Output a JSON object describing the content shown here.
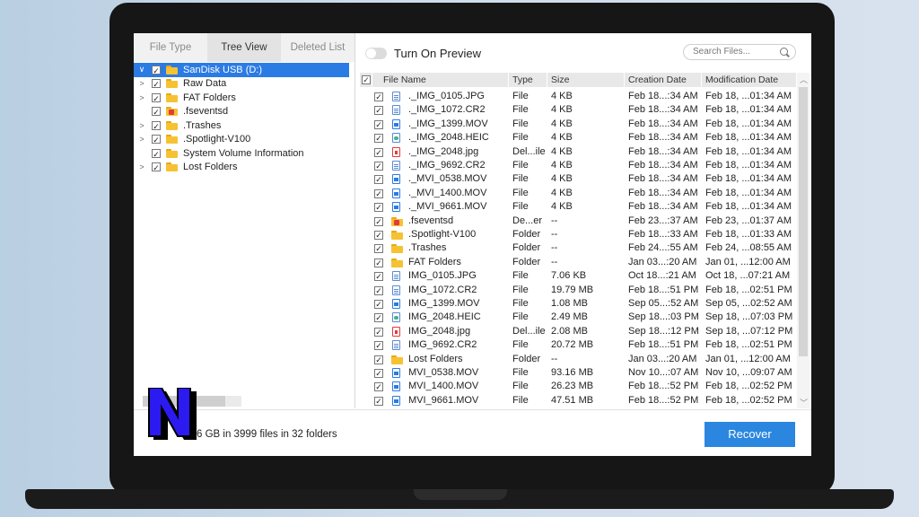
{
  "tabs": [
    "File Type",
    "Tree View",
    "Deleted List"
  ],
  "tree": [
    {
      "label": "SanDisk USB (D:)",
      "chevron": "∨",
      "checked": true,
      "selected": true
    },
    {
      "label": "Raw Data",
      "chevron": ">",
      "checked": true
    },
    {
      "label": "FAT Folders",
      "chevron": ">",
      "checked": true
    },
    {
      "label": ".fseventsd",
      "chevron": "",
      "checked": true,
      "locked": true
    },
    {
      "label": ".Trashes",
      "chevron": ">",
      "checked": true
    },
    {
      "label": ".Spotlight-V100",
      "chevron": ">",
      "checked": true
    },
    {
      "label": "System Volume Information",
      "chevron": "",
      "checked": true
    },
    {
      "label": "Lost Folders",
      "chevron": ">",
      "checked": true
    }
  ],
  "preview": {
    "label": "Turn On Preview"
  },
  "search": {
    "placeholder": "Search Files..."
  },
  "columns": [
    "File Name",
    "Type",
    "Size",
    "Creation Date",
    "Modification Date"
  ],
  "files": [
    {
      "name": "._IMG_0105.JPG",
      "type": "File",
      "size": "4 KB",
      "created": "Feb 18...:34 AM",
      "modified": "Feb 18, ...01:34 AM",
      "icon": "img"
    },
    {
      "name": "._IMG_1072.CR2",
      "type": "File",
      "size": "4 KB",
      "created": "Feb 18...:34 AM",
      "modified": "Feb 18, ...01:34 AM",
      "icon": "img"
    },
    {
      "name": "._IMG_1399.MOV",
      "type": "File",
      "size": "4 KB",
      "created": "Feb 18...:34 AM",
      "modified": "Feb 18, ...01:34 AM",
      "icon": "mov"
    },
    {
      "name": "._IMG_2048.HEIC",
      "type": "File",
      "size": "4 KB",
      "created": "Feb 18...:34 AM",
      "modified": "Feb 18, ...01:34 AM",
      "icon": "heic"
    },
    {
      "name": "._IMG_2048.jpg",
      "type": "Del...ile",
      "size": "4 KB",
      "created": "Feb 18...:34 AM",
      "modified": "Feb 18, ...01:34 AM",
      "icon": "del"
    },
    {
      "name": "._IMG_9692.CR2",
      "type": "File",
      "size": "4 KB",
      "created": "Feb 18...:34 AM",
      "modified": "Feb 18, ...01:34 AM",
      "icon": "img"
    },
    {
      "name": "._MVI_0538.MOV",
      "type": "File",
      "size": "4 KB",
      "created": "Feb 18...:34 AM",
      "modified": "Feb 18, ...01:34 AM",
      "icon": "mov"
    },
    {
      "name": "._MVI_1400.MOV",
      "type": "File",
      "size": "4 KB",
      "created": "Feb 18...:34 AM",
      "modified": "Feb 18, ...01:34 AM",
      "icon": "mov"
    },
    {
      "name": "._MVI_9661.MOV",
      "type": "File",
      "size": "4 KB",
      "created": "Feb 18...:34 AM",
      "modified": "Feb 18, ...01:34 AM",
      "icon": "mov"
    },
    {
      "name": ".fseventsd",
      "type": "De...er",
      "size": "--",
      "created": "Feb 23...:37 AM",
      "modified": "Feb 23, ...01:37 AM",
      "icon": "folder-locked"
    },
    {
      "name": ".Spotlight-V100",
      "type": "Folder",
      "size": "--",
      "created": "Feb 18...:33 AM",
      "modified": "Feb 18, ...01:33 AM",
      "icon": "folder"
    },
    {
      "name": ".Trashes",
      "type": "Folder",
      "size": "--",
      "created": "Feb 24...:55 AM",
      "modified": "Feb 24, ...08:55 AM",
      "icon": "folder"
    },
    {
      "name": "FAT Folders",
      "type": "Folder",
      "size": "--",
      "created": "Jan 03...:20 AM",
      "modified": "Jan 01, ...12:00 AM",
      "icon": "folder"
    },
    {
      "name": "IMG_0105.JPG",
      "type": "File",
      "size": "7.06 KB",
      "created": "Oct 18...:21 AM",
      "modified": "Oct 18, ...07:21 AM",
      "icon": "img"
    },
    {
      "name": "IMG_1072.CR2",
      "type": "File",
      "size": "19.79 MB",
      "created": "Feb 18...:51 PM",
      "modified": "Feb 18, ...02:51 PM",
      "icon": "img"
    },
    {
      "name": "IMG_1399.MOV",
      "type": "File",
      "size": "1.08 MB",
      "created": "Sep 05...:52 AM",
      "modified": "Sep 05, ...02:52 AM",
      "icon": "mov"
    },
    {
      "name": "IMG_2048.HEIC",
      "type": "File",
      "size": "2.49 MB",
      "created": "Sep 18...:03 PM",
      "modified": "Sep 18, ...07:03 PM",
      "icon": "heic"
    },
    {
      "name": "IMG_2048.jpg",
      "type": "Del...ile",
      "size": "2.08 MB",
      "created": "Sep 18...:12 PM",
      "modified": "Sep 18, ...07:12 PM",
      "icon": "del"
    },
    {
      "name": "IMG_9692.CR2",
      "type": "File",
      "size": "20.72 MB",
      "created": "Feb 18...:51 PM",
      "modified": "Feb 18, ...02:51 PM",
      "icon": "img"
    },
    {
      "name": "Lost Folders",
      "type": "Folder",
      "size": "--",
      "created": "Jan 03...:20 AM",
      "modified": "Jan 01, ...12:00 AM",
      "icon": "folder"
    },
    {
      "name": "MVI_0538.MOV",
      "type": "File",
      "size": "93.16 MB",
      "created": "Nov 10...:07 AM",
      "modified": "Nov 10, ...09:07 AM",
      "icon": "mov"
    },
    {
      "name": "MVI_1400.MOV",
      "type": "File",
      "size": "26.23 MB",
      "created": "Feb 18...:52 PM",
      "modified": "Feb 18, ...02:52 PM",
      "icon": "mov"
    },
    {
      "name": "MVI_9661.MOV",
      "type": "File",
      "size": "47.51 MB",
      "created": "Feb 18...:52 PM",
      "modified": "Feb 18, ...02:52 PM",
      "icon": "mov"
    }
  ],
  "status": "6 GB in 3999 files in 32 folders",
  "recover_label": "Recover",
  "colors": {
    "accent": "#2b86e0",
    "selection": "#2b7be4",
    "folder": "#f6c233"
  }
}
